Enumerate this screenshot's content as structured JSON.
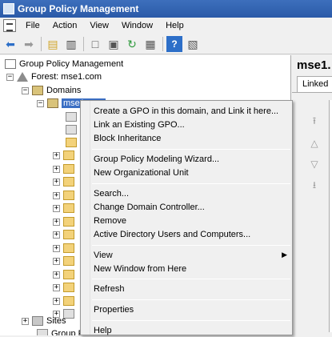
{
  "window": {
    "title": "Group Policy Management"
  },
  "menubar": {
    "items": [
      "File",
      "Action",
      "View",
      "Window",
      "Help"
    ]
  },
  "toolbar": {
    "buttons": [
      "back",
      "forward",
      "up",
      "show-hide-tree",
      "properties",
      "refresh",
      "export",
      "help",
      "show-hide-action-pane"
    ]
  },
  "tree": {
    "root": "Group Policy Management",
    "forest": "Forest: mse1.com",
    "domains": "Domains",
    "domain": "mse1.com",
    "sites": "Sites",
    "group_policy_modeling": "Group P"
  },
  "right_pane": {
    "title": "mse1.",
    "tab": "Linked"
  },
  "context_menu": {
    "items": [
      "Create a GPO in this domain, and Link it here...",
      "Link an Existing GPO...",
      "Block Inheritance",
      "Group Policy Modeling Wizard...",
      "New Organizational Unit",
      "Search...",
      "Change Domain Controller...",
      "Remove",
      "Active Directory Users and Computers...",
      "View",
      "New Window from Here",
      "Refresh",
      "Properties",
      "Help"
    ]
  },
  "icons": {
    "app": "gpmc-icon",
    "forest": "forest-icon",
    "domain": "domain-icon",
    "ou": "folder-icon",
    "gpo": "gpo-icon"
  },
  "colors": {
    "titlebar": "#2a5aa8",
    "selection": "#3b6fc4"
  }
}
